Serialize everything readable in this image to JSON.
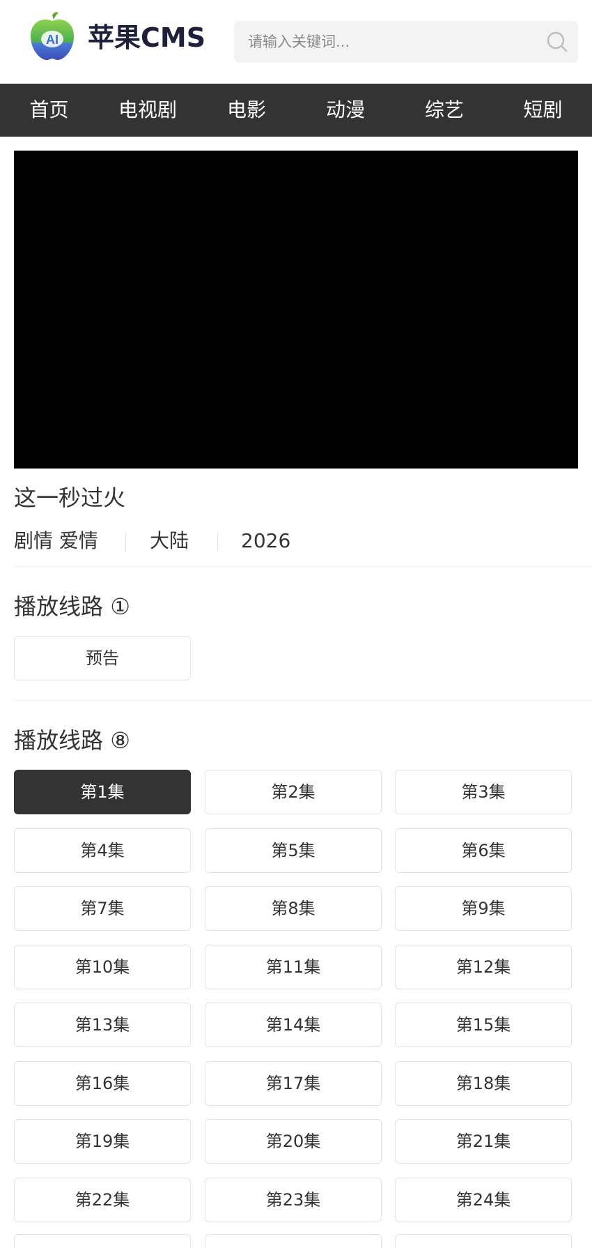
{
  "header": {
    "brand": "苹果CMS",
    "logo_text": "AI",
    "search_placeholder": "请输入关键词..."
  },
  "nav": {
    "items": [
      {
        "label": "首页"
      },
      {
        "label": "电视剧"
      },
      {
        "label": "电影"
      },
      {
        "label": "动漫"
      },
      {
        "label": "综艺"
      },
      {
        "label": "短剧"
      }
    ]
  },
  "video": {
    "title": "这一秒过火",
    "genre": "剧情 爱情",
    "region": "大陆",
    "year": "2026"
  },
  "sources": [
    {
      "label": "播放线路",
      "index": "①",
      "episodes": [
        "预告"
      ],
      "active": -1
    },
    {
      "label": "播放线路",
      "index": "⑧",
      "episodes": [
        "第1集",
        "第2集",
        "第3集",
        "第4集",
        "第5集",
        "第6集",
        "第7集",
        "第8集",
        "第9集",
        "第10集",
        "第11集",
        "第12集",
        "第13集",
        "第14集",
        "第15集",
        "第16集",
        "第17集",
        "第18集",
        "第19集",
        "第20集",
        "第21集",
        "第22集",
        "第23集",
        "第24集"
      ],
      "active": 0
    }
  ],
  "colors": {
    "nav_bg": "#333333",
    "active_bg": "#333333",
    "logo_green": "#6cbf2f",
    "logo_blue": "#3a6fcf"
  },
  "icons": {
    "search": "search-icon",
    "logo": "apple-logo-icon"
  }
}
